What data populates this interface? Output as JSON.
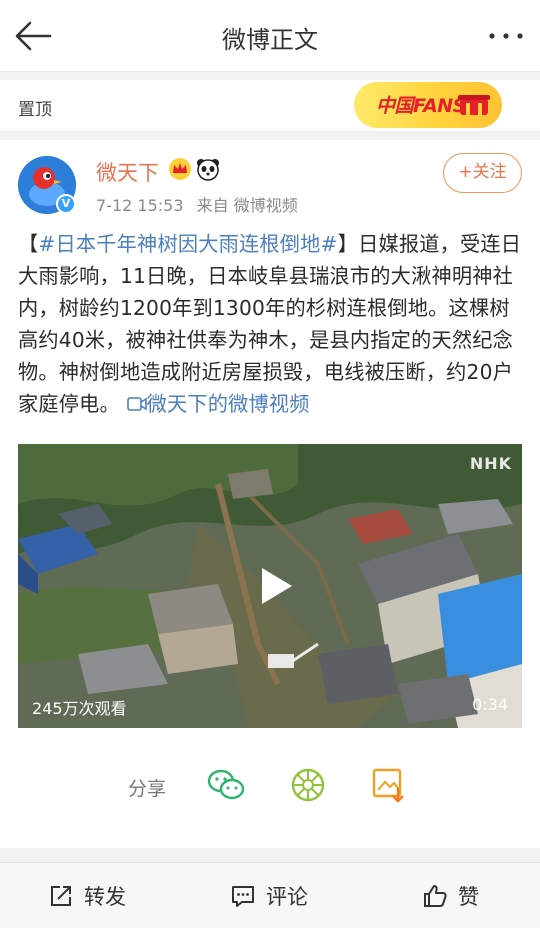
{
  "nav": {
    "title": "微博正文",
    "back_icon": "arrow-left-icon",
    "more_icon": "more-dots-icon"
  },
  "pinned": {
    "label": "置顶",
    "badge_text": "中国FANS"
  },
  "post": {
    "author": "微天下",
    "timestamp": "7-12 15:53",
    "source": "来自 微博视频",
    "follow_label": "+关注",
    "text_tag": "#日本千年神树因大雨连根倒地#",
    "text_open": "【",
    "text_close": "】",
    "text_body": "日媒报道，受连日大雨影响，11日晚，日本岐阜县瑞浪市的大湫神明神社内，树龄约1200年到1300年的杉树连根倒地。这棵树高约40米，被神社供奉为神木，是县内指定的天然纪念物。神树倒地造成附近房屋损毁，电线被压断，约20户家庭停电。",
    "video_link": "微天下的微博视频",
    "video": {
      "views": "245万次观看",
      "duration": "0:34",
      "watermark": "NHK"
    },
    "share_label": "分享"
  },
  "actions": {
    "repost": "转发",
    "comment": "评论",
    "like": "赞"
  },
  "colors": {
    "orange": "#eb7350",
    "link": "#4b7fbf",
    "green": "#2fb46e"
  }
}
